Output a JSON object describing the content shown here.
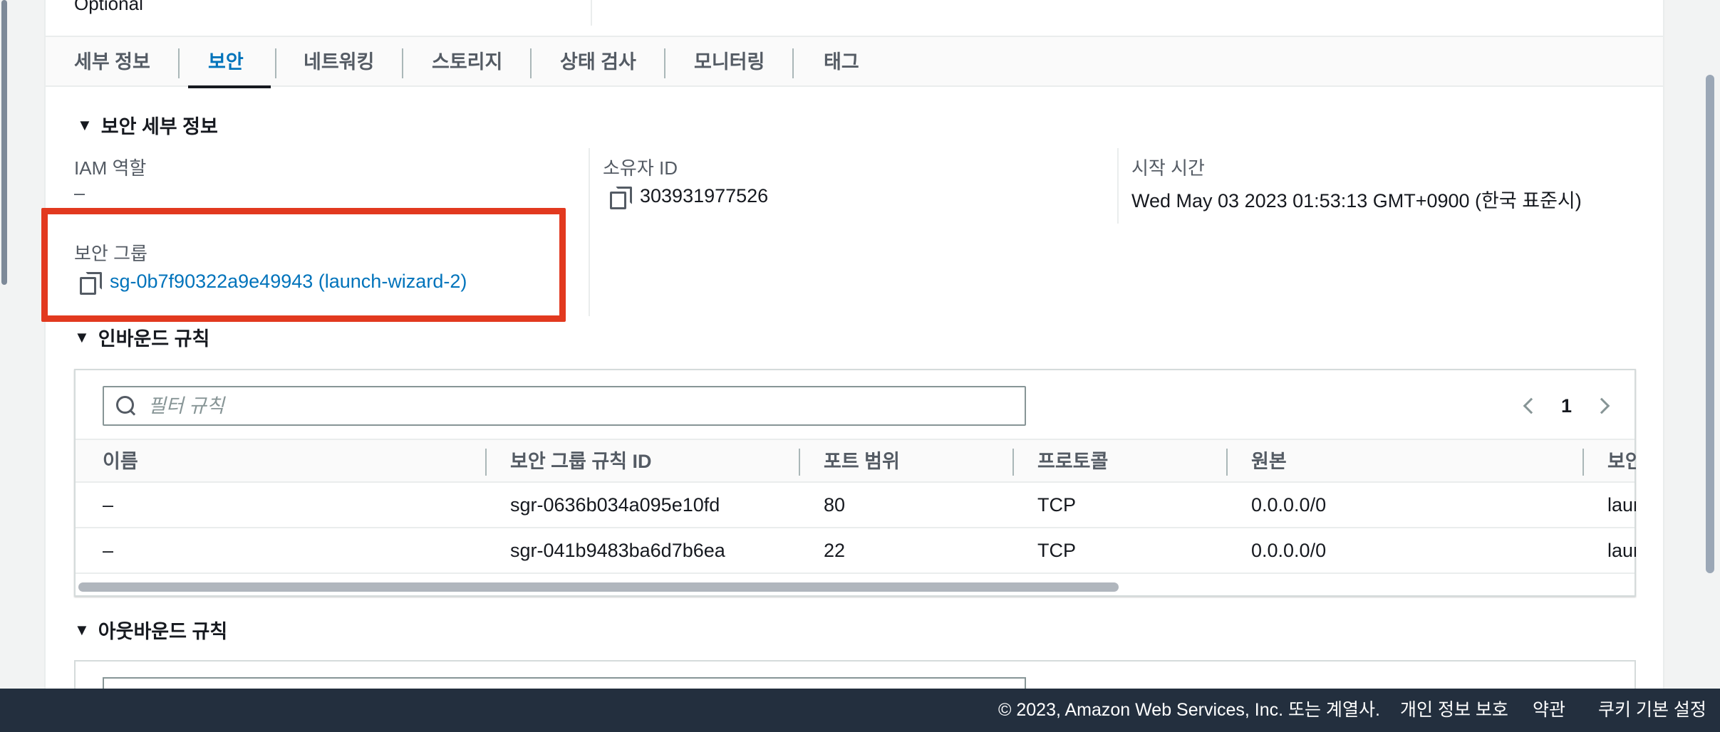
{
  "top_row": {
    "optional": "Optional"
  },
  "tabs": [
    {
      "label": "세부 정보",
      "active": false
    },
    {
      "label": "보안",
      "active": true
    },
    {
      "label": "네트워킹",
      "active": false
    },
    {
      "label": "스토리지",
      "active": false
    },
    {
      "label": "상태 검사",
      "active": false
    },
    {
      "label": "모니터링",
      "active": false
    },
    {
      "label": "태그",
      "active": false
    }
  ],
  "security_details": {
    "title": "보안 세부 정보",
    "iam_role_label": "IAM 역할",
    "iam_role_value": "–",
    "owner_id_label": "소유자 ID",
    "owner_id_value": "303931977526",
    "launch_time_label": "시작 시간",
    "launch_time_value": "Wed May 03 2023 01:53:13 GMT+0900 (한국 표준시)",
    "security_groups_label": "보안 그룹",
    "security_group_link": "sg-0b7f90322a9e49943 (launch-wizard-2)"
  },
  "inbound": {
    "title": "인바운드 규칙",
    "filter_placeholder": "필터 규칙",
    "page": "1",
    "columns": [
      "이름",
      "보안 그룹 규칙 ID",
      "포트 범위",
      "프로토콜",
      "원본",
      "보안"
    ],
    "rows": [
      {
        "name": "–",
        "rule_id": "sgr-0636b034a095e10fd",
        "port": "80",
        "protocol": "TCP",
        "source": "0.0.0.0/0",
        "sg": "laun"
      },
      {
        "name": "–",
        "rule_id": "sgr-041b9483ba6d7b6ea",
        "port": "22",
        "protocol": "TCP",
        "source": "0.0.0.0/0",
        "sg": "laun"
      }
    ]
  },
  "outbound": {
    "title": "아웃바운드 규칙"
  },
  "footer": {
    "copyright": "© 2023, Amazon Web Services, Inc. 또는 계열사.",
    "privacy": "개인 정보 보호",
    "terms": "약관",
    "cookies": "쿠키 기본 설정"
  },
  "colors": {
    "accent": "#0073bb",
    "highlight": "#e2391f",
    "footer_bg": "#232f3e"
  }
}
